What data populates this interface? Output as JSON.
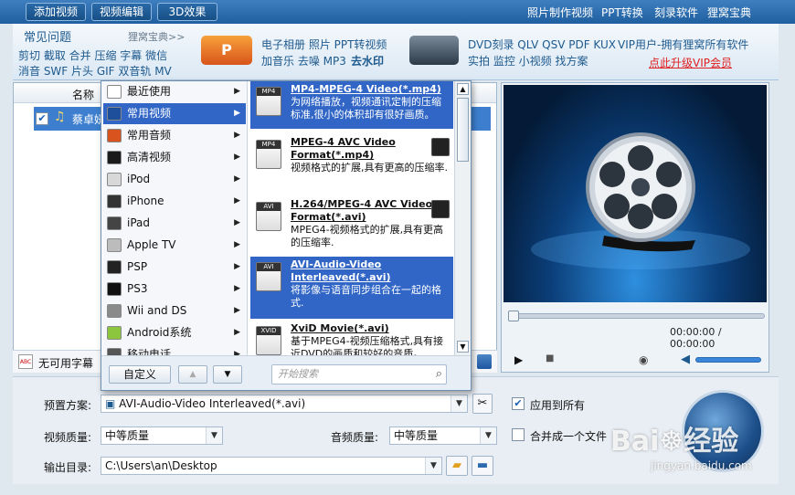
{
  "toolbar": {
    "add_video": "添加视频",
    "video_edit": "视频编辑",
    "effect_3d": "3D效果",
    "links": [
      "照片制作视频",
      "PPT转换",
      "刻录软件",
      "狸窝宝典"
    ]
  },
  "promo": {
    "faq_title": "常见问题",
    "wiki_link": "狸窝宝典>>",
    "faq_row1": "剪切 截取 合并 压缩 字幕 微信",
    "faq_row2": "消音 SWF 片头 GIF 双音轨 MV",
    "ppt_line1": "电子相册 照片 PPT转视频",
    "ppt_line2a": "加音乐 去噪 MP3",
    "ppt_line2b": "去水印",
    "dvd_line1": "DVD刻录 QLV QSV PDF KUX",
    "dvd_line2": "实拍 监控 小视频 找方案",
    "vip_line1": "VIP用户-拥有狸窝所有软件",
    "vip_link": "点此升级VIP会员"
  },
  "filelist": {
    "col_name": "名称",
    "file_name": "蔡卓妍",
    "subtitle_label": "无可用字幕"
  },
  "menu": {
    "categories": [
      {
        "label": "最近使用",
        "icon": "clock-icon",
        "color": "#ffffff"
      },
      {
        "label": "常用视频",
        "icon": "film-icon",
        "color": "#1d4f9a"
      },
      {
        "label": "常用音频",
        "icon": "music-icon",
        "color": "#d9531e"
      },
      {
        "label": "高清视频",
        "icon": "hd-icon",
        "color": "#1a1a1a"
      },
      {
        "label": "iPod",
        "icon": "ipod-icon",
        "color": "#d8d8d8"
      },
      {
        "label": "iPhone",
        "icon": "iphone-icon",
        "color": "#333333"
      },
      {
        "label": "iPad",
        "icon": "ipad-icon",
        "color": "#444444"
      },
      {
        "label": "Apple TV",
        "icon": "apple-icon",
        "color": "#bcbcbc"
      },
      {
        "label": "PSP",
        "icon": "psp-icon",
        "color": "#222222"
      },
      {
        "label": "PS3",
        "icon": "ps3-icon",
        "color": "#111111"
      },
      {
        "label": "Wii and DS",
        "icon": "wii-icon",
        "color": "#8a8a8a"
      },
      {
        "label": "Android系统",
        "icon": "android-icon",
        "color": "#8cc63f"
      },
      {
        "label": "移动电话",
        "icon": "phone-icon",
        "color": "#555555"
      }
    ],
    "selected_category": 1,
    "formats": [
      {
        "tag": "MP4",
        "title": "MP4-MPEG-4 Video(*.mp4)",
        "desc": "为网络播放，视频通讯定制的压缩标准,很小的体积却有很好画质。",
        "nvidia": false
      },
      {
        "tag": "MP4",
        "title": "MPEG-4 AVC Video Format(*.mp4)",
        "desc": "视频格式的扩展,具有更高的压缩率.",
        "nvidia": true
      },
      {
        "tag": "AVI",
        "title": "H.264/MPEG-4 AVC Video Format(*.avi)",
        "desc": "MPEG4-视频格式的扩展,具有更高的压缩率.",
        "nvidia": true
      },
      {
        "tag": "AVI",
        "title": "AVI-Audio-Video Interleaved(*.avi)",
        "desc": "将影像与语音同步组合在一起的格式.",
        "nvidia": false
      },
      {
        "tag": "XVID",
        "title": "XviD Movie(*.avi)",
        "desc": "基于MPEG4-视频压缩格式,具有接近DVD的画质和较好的音质。",
        "nvidia": false
      }
    ],
    "custom_button": "自定义",
    "search_placeholder": "开始搜索"
  },
  "preview": {
    "time": "00:00:00 / 00:00:00"
  },
  "settings": {
    "preset_label": "预置方案:",
    "preset_value": "AVI-Audio-Video Interleaved(*.avi)",
    "apply_all": "应用到所有",
    "video_quality_label": "视频质量:",
    "video_quality_value": "中等质量",
    "audio_quality_label": "音频质量:",
    "audio_quality_value": "中等质量",
    "merge_label": "合并成一个文件",
    "output_label": "输出目录:",
    "output_value": "C:\\Users\\an\\Desktop"
  },
  "watermark": {
    "text1": "Bai",
    "text2": "经验",
    "url": "jingyan.baidu.com"
  },
  "colors": {
    "accent": "#3166c6",
    "toolbar": "#1f5f9f",
    "vip_red": "#e02020"
  }
}
